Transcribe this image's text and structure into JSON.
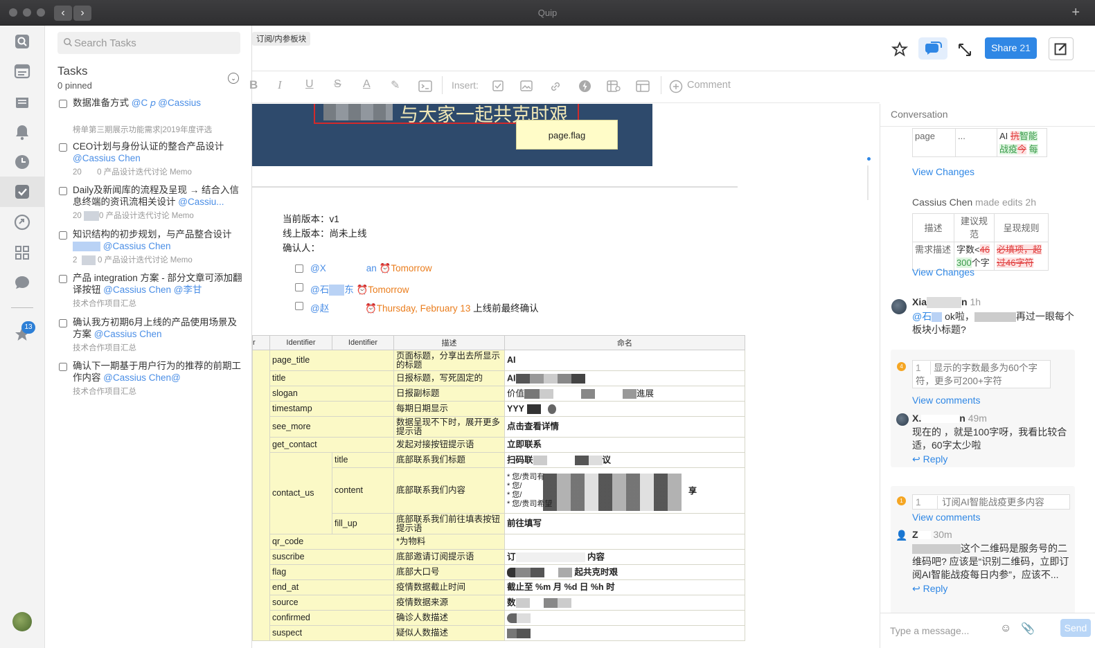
{
  "window": {
    "title": "Quip",
    "back": "‹",
    "forward": "›",
    "new_tab": "+"
  },
  "rail": {
    "badge_count": "13"
  },
  "tasks": {
    "search_placeholder": "Search Tasks",
    "heading": "Tasks",
    "pinned": "0 pinned",
    "items": [
      {
        "title": "数据准备方式",
        "mentions": "@C            𝑝 @Cassius",
        "meta": "榜单第三期展示功能需求|2019年度评选"
      },
      {
        "title": "CEO计划与身份认证的整合产品设计",
        "mentions": "@Cassius Chen",
        "meta": "0 产品设计迭代讨论 Memo",
        "meta_prefix": "20"
      },
      {
        "title": "Daily及新闻库的流程及呈现 → 结合入信息终端的资讯流相关设计",
        "mentions": "@Cassiu...",
        "meta": "0 产品设计迭代讨论 Memo",
        "meta_prefix": "20"
      },
      {
        "title": "知识结构的初步规划，与产品整合设计",
        "mentions": "@Cassius Chen",
        "meta": "0 产品设计迭代讨论 Memo",
        "meta_prefix": "2"
      },
      {
        "title": "产品 integration 方案 - 部分文章可添加翻译按钮",
        "mentions": "@Cassius Chen @李甘",
        "meta": "技术合作项目汇总"
      },
      {
        "title": "确认我方初期6月上线的产品使用场景及方案",
        "mentions": "@Cassius Chen",
        "meta": "技术合作项目汇总"
      },
      {
        "title": "确认下一期基于用户行为的推荐的前期工作内容",
        "mentions": "@Cassius Chen@",
        "meta": "技术合作项目汇总"
      }
    ]
  },
  "doc": {
    "breadcrumb": "订阅/内参板块",
    "share_label": "Share",
    "share_count": "21",
    "toolbar": {
      "insert_label": "Insert:",
      "comment_label": "Comment"
    },
    "banner_text": "与大家一起共克时艰",
    "page_flag": "page.flag",
    "current_version": "当前版本：v1",
    "online_version": "线上版本：尚未上线",
    "confirmer": "确认人：",
    "checklist": [
      {
        "mention": "@X",
        "mention2": "an",
        "due": "Tomorrow",
        "note": ""
      },
      {
        "mention": "@石",
        "mention2": "东",
        "due": "Tomorrow",
        "note": ""
      },
      {
        "mention": "@赵",
        "mention2": "",
        "due": "Thursday, February 13",
        "note": "上线前最终确认"
      }
    ],
    "table": {
      "headers": [
        "r",
        "Identifier",
        "Identifier",
        "描述",
        "命名"
      ],
      "rows": [
        {
          "id": "page_title",
          "sub": "",
          "desc": "页面标题，分享出去所显示的标题",
          "name": "AI"
        },
        {
          "id": "title",
          "sub": "",
          "desc": "日报标题，写死固定的",
          "name": "AI"
        },
        {
          "id": "slogan",
          "sub": "",
          "desc": "日报副标题",
          "name": "价值",
          "name_tail": "進展"
        },
        {
          "id": "timestamp",
          "sub": "",
          "desc": "每期日期显示",
          "name": "YYY"
        },
        {
          "id": "see_more",
          "sub": "",
          "desc": "数据呈现不下时，展开更多提示语",
          "name": "点击查看详情"
        },
        {
          "id": "get_contact",
          "sub": "",
          "desc": "发起对接按钮提示语",
          "name": "立即联系"
        },
        {
          "id": "contact_us",
          "sub": "title",
          "desc": "底部联系我们标题",
          "name": "扫码联",
          "name_tail": "议"
        },
        {
          "id": "",
          "sub": "content",
          "desc": "底部联系我们内容",
          "name": "* 您/贵司有\n* 您/\n* 您/\n* 您/贵司希望",
          "name_tail": "享"
        },
        {
          "id": "",
          "sub": "fill_up",
          "desc": "底部联系我们前往填表按钮提示语",
          "name": "前往填写"
        },
        {
          "id": "qr_code",
          "sub": "",
          "desc": "*为物料",
          "name": ""
        },
        {
          "id": "suscribe",
          "sub": "",
          "desc": "底部邀请订阅提示语",
          "name": "订",
          "name_tail": "内容"
        },
        {
          "id": "flag",
          "sub": "",
          "desc": "底部大口号",
          "name": "",
          "name_tail": "起共克时艰"
        },
        {
          "id": "end_at",
          "sub": "",
          "desc": "疫情数据截止时间",
          "name": "截止至 %m 月 %d 日 %h 时"
        },
        {
          "id": "source",
          "sub": "",
          "desc": "疫情数据来源",
          "name": "数"
        },
        {
          "id": "confirmed",
          "sub": "",
          "desc": "确诊人数描述",
          "name": ""
        },
        {
          "id": "suspect",
          "sub": "",
          "desc": "疑似人数描述",
          "name": ""
        }
      ]
    }
  },
  "conversation": {
    "heading": "Conversation",
    "diff1": {
      "c1": "page",
      "c2": "...",
      "c3_a": "AI ",
      "c3_del": "抗",
      "c3_ins": "智能",
      "c3_b": "战疫",
      "c3_del2": "今",
      "c3_ins2": "每"
    },
    "view_changes": "View Changes",
    "edit_author": "Cassius Chen",
    "edit_action": "made edits",
    "edit_time": "2h",
    "diff2": {
      "h1": "描述",
      "h2": "建议规范",
      "h3": "呈现规则",
      "r1": "需求描述",
      "r2a": "字数<",
      "r2del": "46",
      "r2ins": "300",
      "r2b": "个字",
      "r3del": "必填项，超过46字符"
    },
    "msg1": {
      "author": "Xia",
      "author_tail": "n",
      "time": "1h",
      "mention": "@石",
      "text_a": "ok啦，",
      "text_b": "再过一眼每个板块小标题?"
    },
    "thread1": {
      "num": "4",
      "line": "1",
      "quote": "显示的字数最多为60个字符，更多可200+字符"
    },
    "view_comments": "View comments",
    "msg2": {
      "author": "X.",
      "author_tail": "n",
      "time": "49m",
      "text": "现在的 ，就是100字呀，我看比较合适，60字太少啦"
    },
    "reply": "Reply",
    "thread2": {
      "num": "1",
      "line": "1",
      "quote": "订阅AI智能战疫更多内容"
    },
    "msg3": {
      "author": "Z",
      "time": "30m",
      "text": "这个二维码是服务号的二维码吧? 应该是“识别二维码，立即订阅AI智能战疫每日内参”，应该不..."
    },
    "message_placeholder": "Type a message...",
    "send": "Send"
  }
}
